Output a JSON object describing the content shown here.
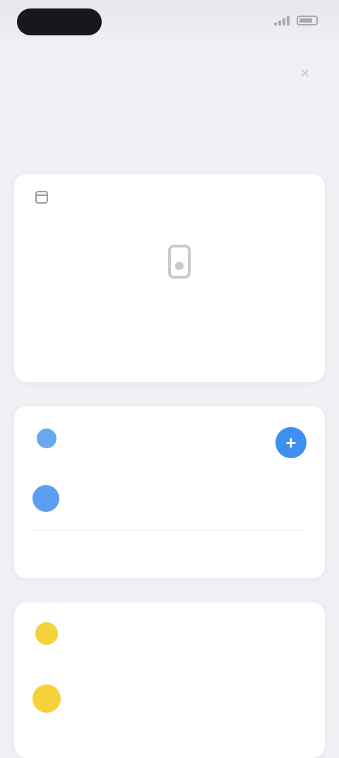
{
  "status_bar": {
    "time": "",
    "signal_icon": "signal-icon",
    "battery_icon": "battery-icon"
  },
  "header": {
    "close_icon": "close-icon",
    "close_symbol": "×",
    "title": ""
  },
  "empty_card": {
    "header_label": "",
    "title": "",
    "subtitle": ""
  },
  "card_blue": {
    "title": "",
    "subtitle": "",
    "action_symbol": "+",
    "row_label": "",
    "footer_text": "",
    "accent_color": "#3d8ff0"
  },
  "card_yellow": {
    "title": "",
    "subtitle": "",
    "row_label": "",
    "accent_color": "#f4d33a"
  }
}
